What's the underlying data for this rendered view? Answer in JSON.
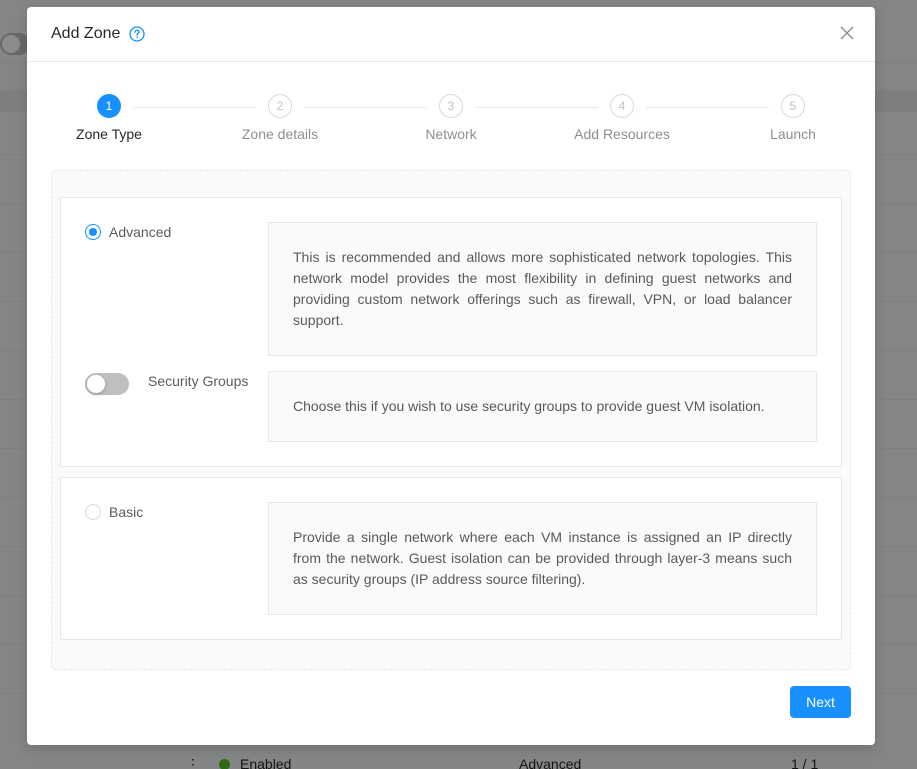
{
  "background": {
    "row": {
      "status": "Enabled",
      "network_type": "Advanced",
      "count": "1 / 1",
      "menu_glyph": "⋮"
    }
  },
  "modal": {
    "title": "Add Zone",
    "help_icon": "question-circle-icon",
    "close_icon": "close-icon"
  },
  "steps": [
    {
      "number": "1",
      "label": "Zone Type",
      "active": true
    },
    {
      "number": "2",
      "label": "Zone details",
      "active": false
    },
    {
      "number": "3",
      "label": "Network",
      "active": false
    },
    {
      "number": "4",
      "label": "Add Resources",
      "active": false
    },
    {
      "number": "5",
      "label": "Launch",
      "active": false
    }
  ],
  "zone_types": {
    "advanced": {
      "label": "Advanced",
      "selected": true,
      "description": "This is recommended and allows more sophisticated network topologies. This network model provides the most flexibility in defining guest networks and providing custom network offerings such as firewall, VPN, or load balancer support."
    },
    "security_groups": {
      "label": "Security Groups",
      "enabled": false,
      "description": "Choose this if you wish to use security groups to provide guest VM isolation."
    },
    "basic": {
      "label": "Basic",
      "selected": false,
      "description": "Provide a single network where each VM instance is assigned an IP directly from the network. Guest isolation can be provided through layer-3 means such as security groups (IP address source filtering)."
    }
  },
  "footer": {
    "next_label": "Next"
  },
  "colors": {
    "primary": "#1890ff",
    "success": "#52c41a"
  }
}
